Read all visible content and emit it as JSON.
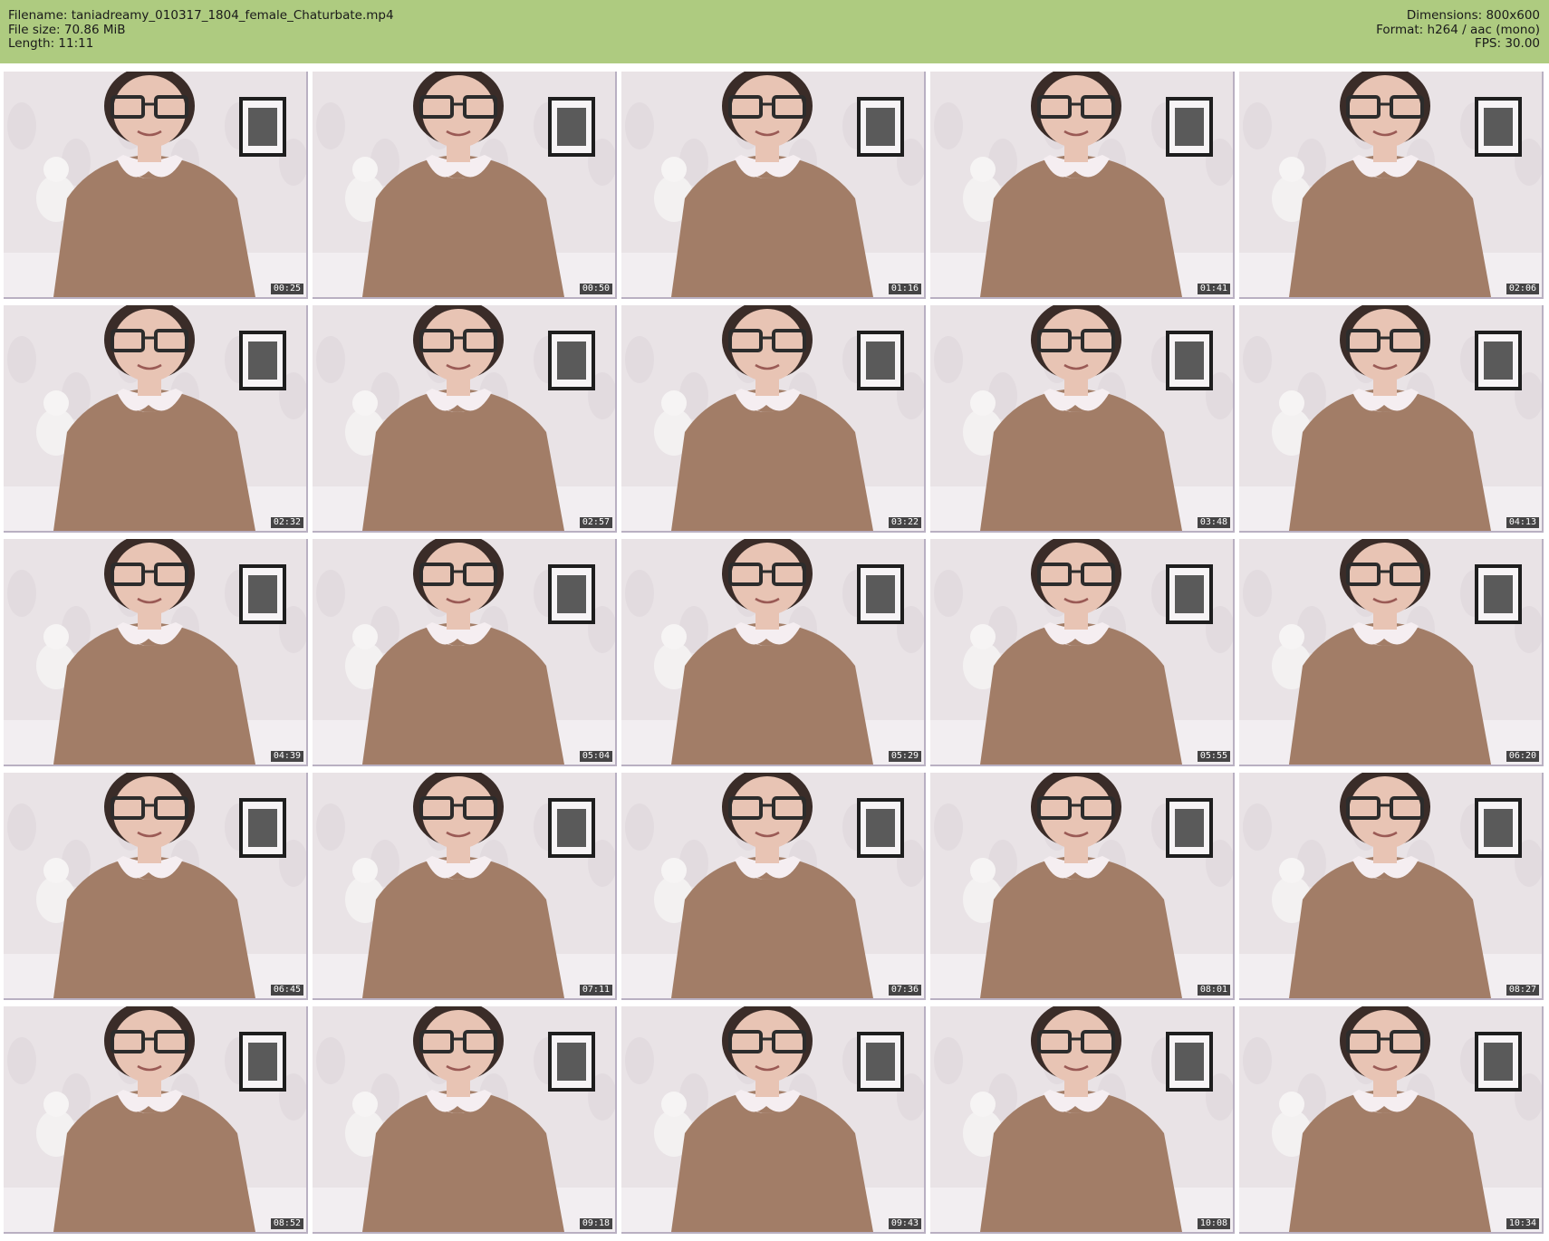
{
  "header": {
    "filename_label": "Filename:",
    "filename": "taniadreamy_010317_1804_female_Chaturbate.mp4",
    "filesize_label": "File size:",
    "filesize": "70.86 MiB",
    "length_label": "Length:",
    "length": "11:11",
    "dimensions_label": "Dimensions:",
    "dimensions": "800x600",
    "format_label": "Format:",
    "format": "h264 / aac (mono)",
    "fps_label": "FPS:",
    "fps": "30.00"
  },
  "frames": [
    {
      "timestamp": "00:25"
    },
    {
      "timestamp": "00:50"
    },
    {
      "timestamp": "01:16"
    },
    {
      "timestamp": "01:41"
    },
    {
      "timestamp": "02:06"
    },
    {
      "timestamp": "02:32"
    },
    {
      "timestamp": "02:57"
    },
    {
      "timestamp": "03:22"
    },
    {
      "timestamp": "03:48"
    },
    {
      "timestamp": "04:13"
    },
    {
      "timestamp": "04:39"
    },
    {
      "timestamp": "05:04"
    },
    {
      "timestamp": "05:29"
    },
    {
      "timestamp": "05:55"
    },
    {
      "timestamp": "06:20"
    },
    {
      "timestamp": "06:45"
    },
    {
      "timestamp": "07:11"
    },
    {
      "timestamp": "07:36"
    },
    {
      "timestamp": "08:01"
    },
    {
      "timestamp": "08:27"
    },
    {
      "timestamp": "08:52"
    },
    {
      "timestamp": "09:18"
    },
    {
      "timestamp": "09:43"
    },
    {
      "timestamp": "10:08"
    },
    {
      "timestamp": "10:34"
    }
  ],
  "colors": {
    "header_bg": "#aecb80",
    "wall": "#e9e3e6",
    "dress": "#a27d67",
    "collar": "#f5eef1",
    "skin": "#e8c4b4",
    "hair": "#3a2c28",
    "glasses": "#2c2c2c"
  }
}
